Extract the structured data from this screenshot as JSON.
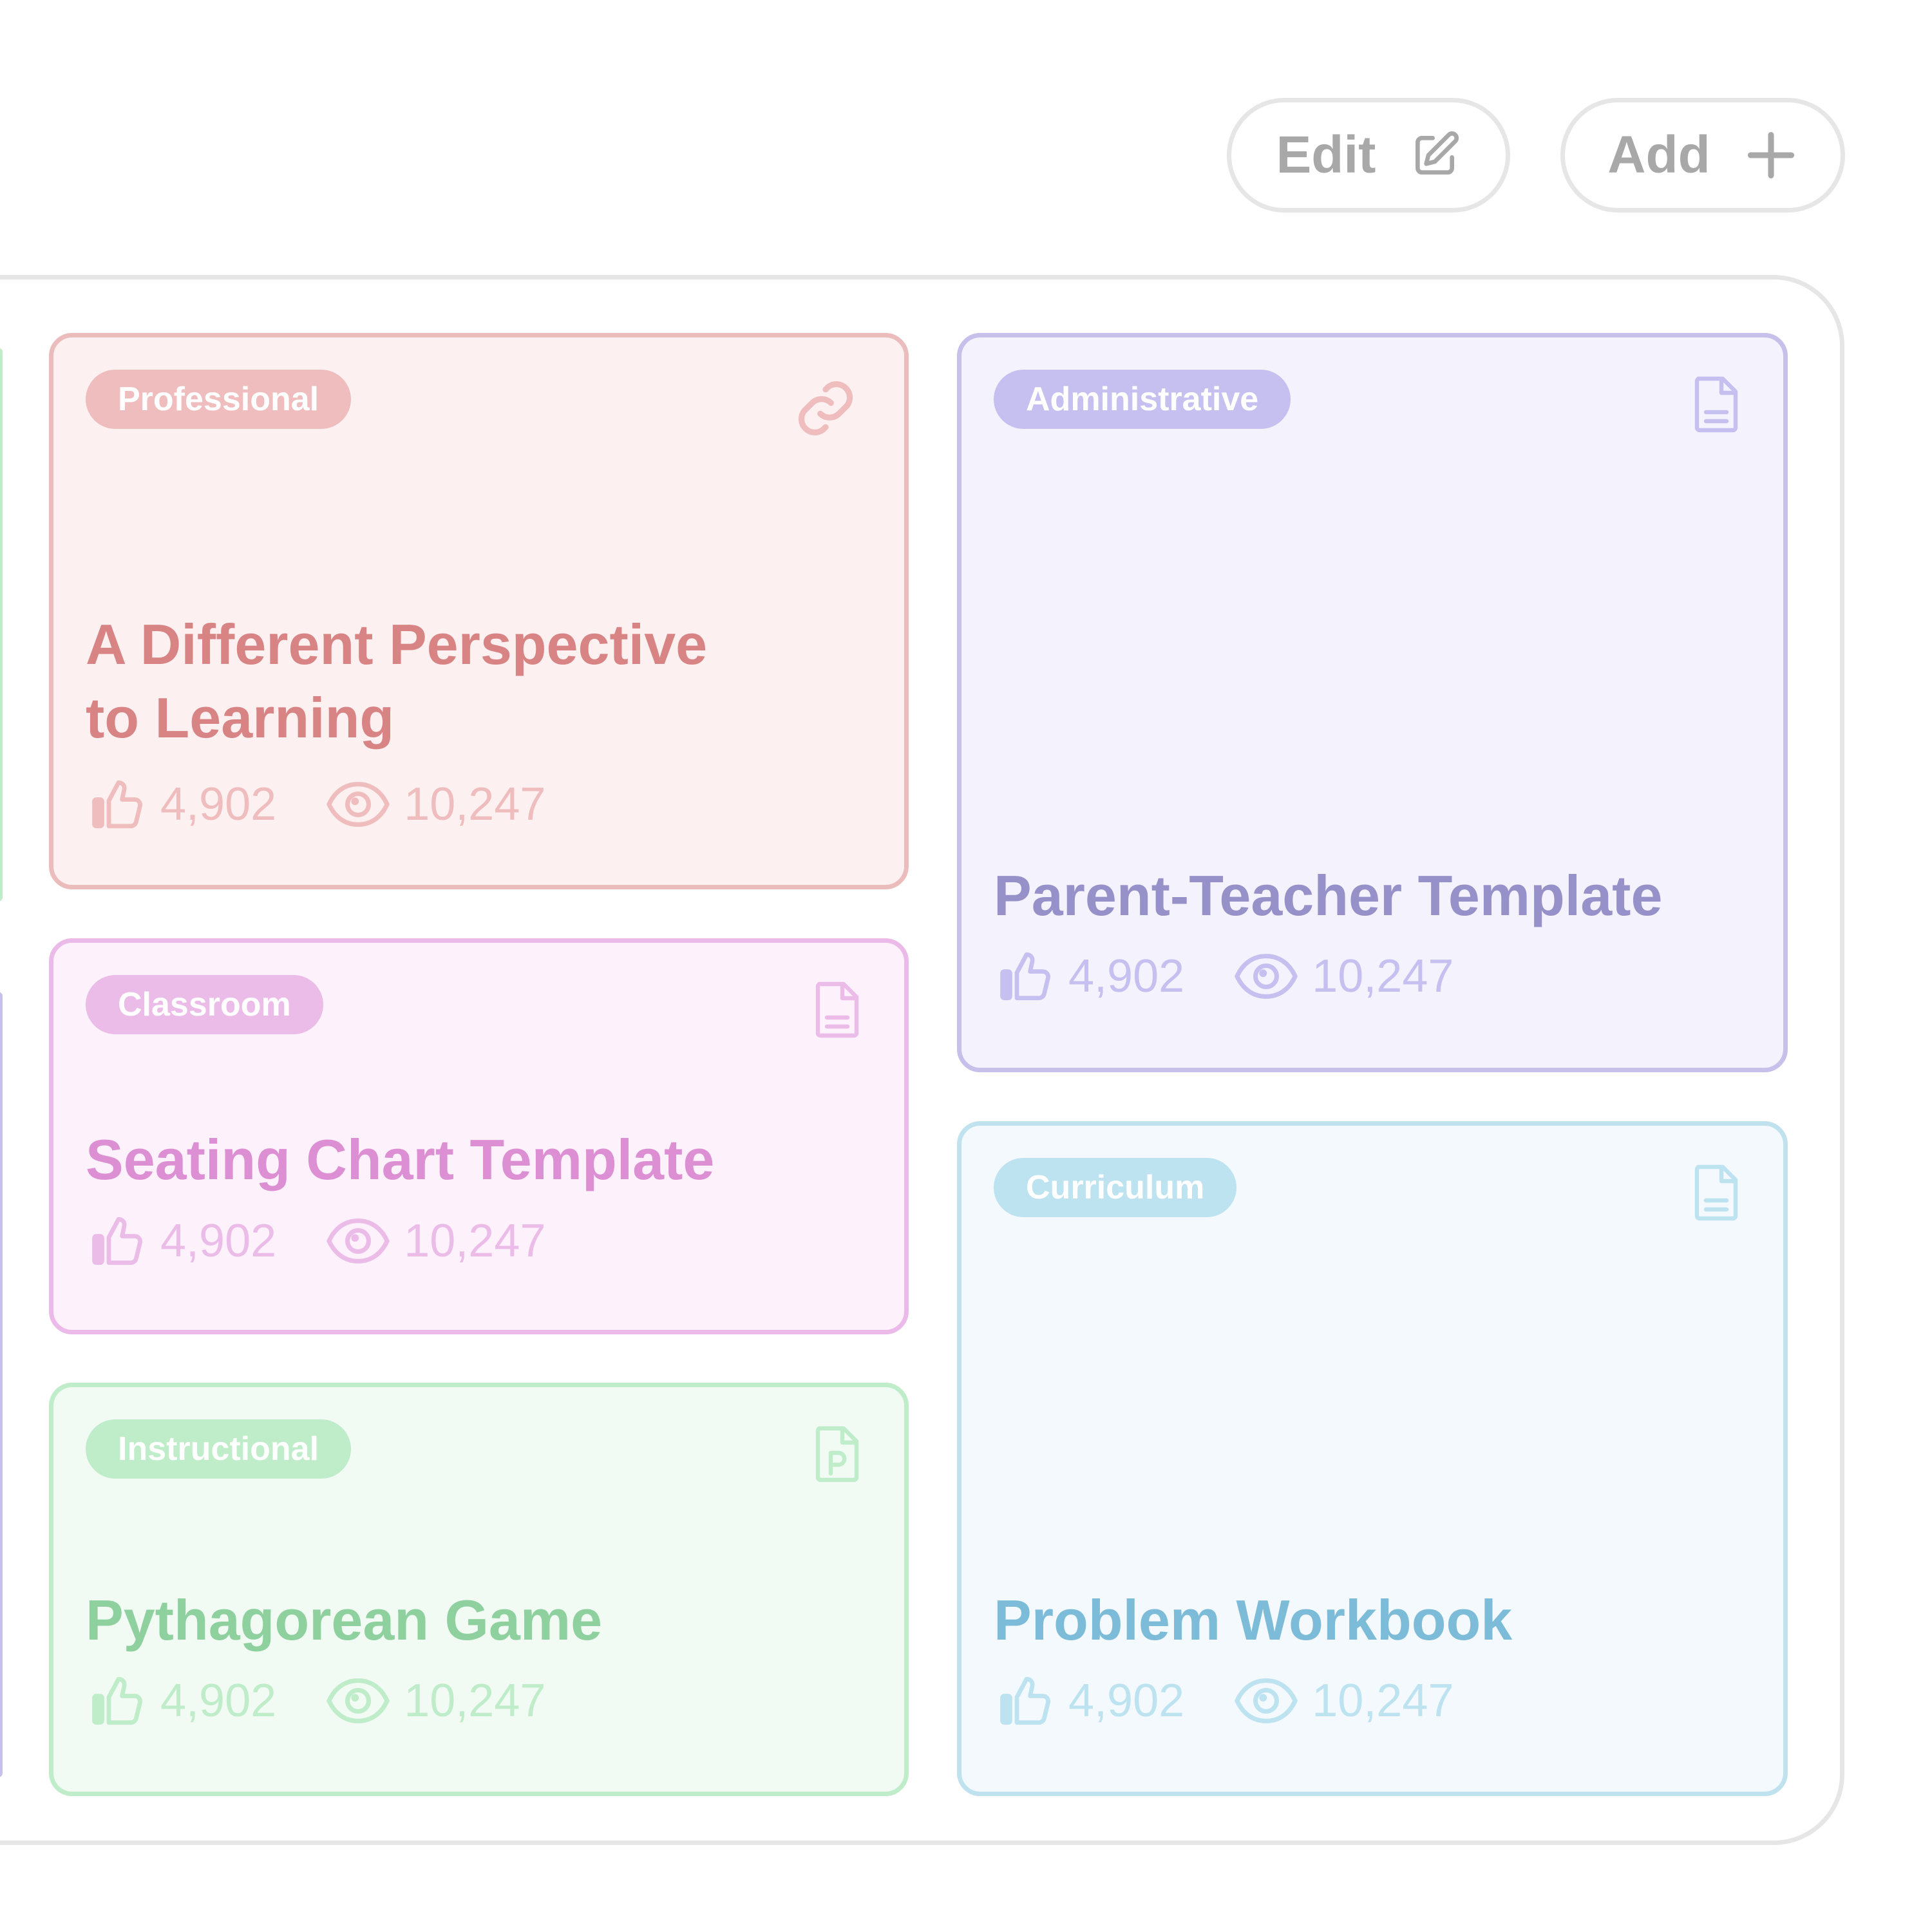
{
  "toolbar": {
    "edit_label": "Edit",
    "edit_icon": "edit-icon",
    "add_label": "Add",
    "add_icon": "plus-icon",
    "button_text_color": "#a8a8a8",
    "button_border_color": "#e6e6e6"
  },
  "cards": [
    {
      "category": "Professional",
      "title_lines": [
        "A Different Perspective",
        "to Learning"
      ],
      "likes": "4,902",
      "views": "10,247",
      "icon": "link-icon",
      "colors": {
        "border": "#ebbcbc",
        "background": "#fcf0f0",
        "badge": "#efbdbd",
        "title": "#d88484",
        "stats": "#efbdbd"
      }
    },
    {
      "category": "Classroom",
      "title": "Seating Chart Template",
      "likes": "4,902",
      "views": "10,247",
      "icon": "document-icon",
      "colors": {
        "border": "#ecbae8",
        "background": "#fdf2fb",
        "badge": "#ecbce8",
        "title": "#dd8fd4",
        "stats": "#ecbce8"
      }
    },
    {
      "category": "Instructional",
      "title": "Pythagorean Game",
      "likes": "4,902",
      "views": "10,247",
      "icon": "presentation-file-icon",
      "colors": {
        "border": "#bfecc9",
        "background": "#f2faf4",
        "badge": "#bfecc9",
        "title": "#8ed19f",
        "stats": "#bfecc9"
      }
    },
    {
      "category": "Administrative",
      "title": "Parent-Teacher Template",
      "likes": "4,902",
      "views": "10,247",
      "icon": "document-icon",
      "colors": {
        "border": "#c6c0ea",
        "background": "#f4f2fd",
        "badge": "#c5c0ef",
        "title": "#9791c9",
        "stats": "#c5c0ef"
      }
    },
    {
      "category": "Curriculum",
      "title": "Problem Workbook",
      "likes": "4,902",
      "views": "10,247",
      "icon": "document-icon",
      "colors": {
        "border": "#bfe2ee",
        "background": "#f3f9fd",
        "badge": "#bde2f0",
        "title": "#7dbcd8",
        "stats": "#bde2f0"
      }
    }
  ],
  "panel_border_color": "#e6e6e6",
  "partial_edge_colors": [
    "#bfecc9",
    "#c6c0ea"
  ]
}
